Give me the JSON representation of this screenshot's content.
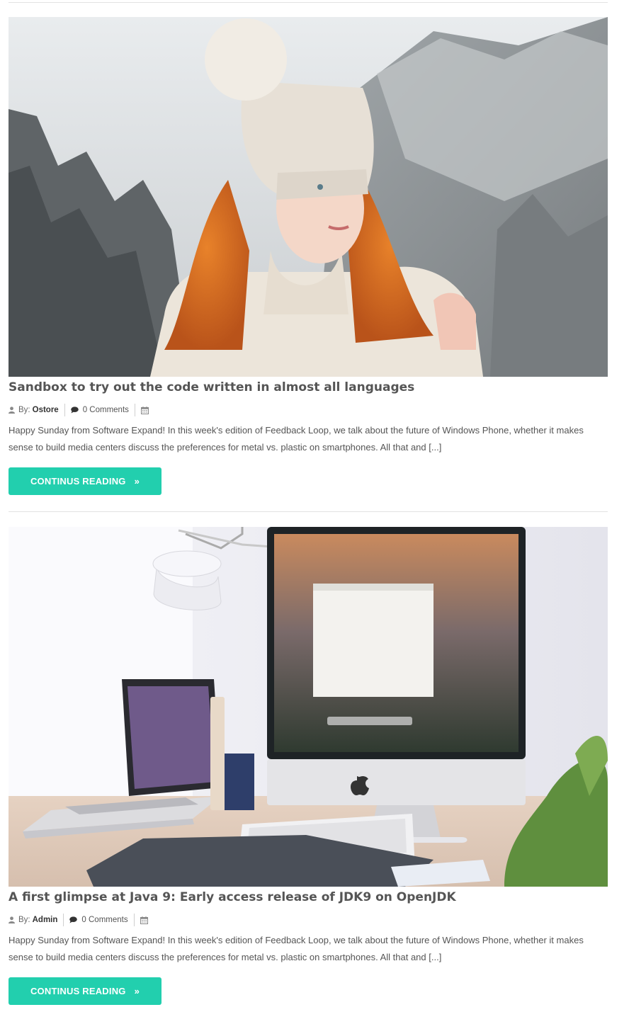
{
  "posts": [
    {
      "image_alt": "Woman in a knit beanie in a snowy forest",
      "title": "Sandbox to try out the code written in almost all languages",
      "author_prefix": "By:",
      "author": "Ostore",
      "comments": "0 Comments",
      "date": "",
      "excerpt": "Happy Sunday from Software Expand! In this week's edition of Feedback Loop, we talk about the future of Windows Phone, whether it makes sense to build media centers discuss the preferences for metal vs. plastic on smartphones. All that and [...]",
      "button_label": "CONTINUS READING",
      "button_icon": "double-chevron-right-icon"
    },
    {
      "image_alt": "Desk with iMac, laptop, keyboard and drawing tablet",
      "title": "A first glimpse at Java 9: Early access release of JDK9 on OpenJDK",
      "author_prefix": "By:",
      "author": "Admin",
      "comments": "0 Comments",
      "date": "",
      "excerpt": "Happy Sunday from Software Expand! In this week's edition of Feedback Loop, we talk about the future of Windows Phone, whether it makes sense to build media centers discuss the preferences for metal vs. plastic on smartphones. All that and [...]",
      "button_label": "CONTINUS READING",
      "button_icon": "double-chevron-right-icon"
    }
  ],
  "colors": {
    "accent": "#22cfae",
    "title": "#555555",
    "text": "#555555",
    "divider": "#e2e2e2"
  }
}
